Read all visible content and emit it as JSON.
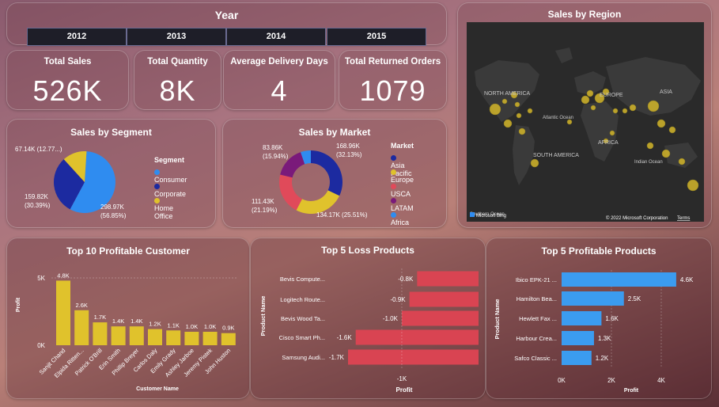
{
  "year_slicer": {
    "title": "Year",
    "years": [
      "2012",
      "2013",
      "2014",
      "2015"
    ]
  },
  "kpis": [
    {
      "label": "Total Sales",
      "value": "526K"
    },
    {
      "label": "Total Quantity",
      "value": "8K"
    },
    {
      "label": "Average Delivery Days",
      "value": "4"
    },
    {
      "label": "Total Returned Orders",
      "value": "1079"
    }
  ],
  "map": {
    "title": "Sales by Region",
    "labels": [
      "NORTH AMERICA",
      "EUROPE",
      "ASIA",
      "Atlantic Ocean",
      "AFRICA",
      "SOUTH AMERICA",
      "Indian Ocean",
      "Southern Ocean"
    ],
    "attribution": "© 2022 Microsoft Corporation",
    "terms": "Terms",
    "logo": "Microsoft Bing",
    "bubble_color": "#d4b62a"
  },
  "charts": {
    "segment": {
      "title": "Sales by Segment",
      "legend_title": "Segment"
    },
    "market": {
      "title": "Sales by Market",
      "legend_title": "Market"
    },
    "customers": {
      "title": "Top 10 Profitable Customer"
    },
    "loss": {
      "title": "Top 5 Loss Products"
    },
    "profit_products": {
      "title": "Top 5 Profitable Products"
    }
  },
  "chart_data": [
    {
      "type": "pie",
      "title": "Sales by Segment",
      "legend_title": "Segment",
      "slices": [
        {
          "name": "Consumer",
          "value": 298.97,
          "label": "298.97K",
          "pct": "(56.85%)",
          "color": "#2f8cf0"
        },
        {
          "name": "Corporate",
          "value": 159.82,
          "label": "159.82K",
          "pct": "(30.39%)",
          "color": "#1c2aa0"
        },
        {
          "name": "Home Office",
          "value": 67.14,
          "label": "67.14K (12.77...)",
          "pct": "",
          "color": "#e0c22c"
        }
      ]
    },
    {
      "type": "pie",
      "subtype": "donut",
      "title": "Sales by Market",
      "legend_title": "Market",
      "slices": [
        {
          "name": "Asia Pacific",
          "value": 168.96,
          "label": "168.96K",
          "pct": "(32.13%)",
          "color": "#1c2aa0"
        },
        {
          "name": "Europe",
          "value": 134.17,
          "label": "134.17K (25.51%)",
          "pct": "",
          "color": "#e0c22c"
        },
        {
          "name": "USCA",
          "value": 111.43,
          "label": "111.43K",
          "pct": "(21.19%)",
          "color": "#e04a5a"
        },
        {
          "name": "LATAM",
          "value": 83.86,
          "label": "83.86K",
          "pct": "(15.94%)",
          "color": "#7a1a7a"
        },
        {
          "name": "Africa",
          "value": 27.6,
          "label": "",
          "pct": "",
          "color": "#2f8cf0"
        }
      ]
    },
    {
      "type": "bar",
      "title": "Top 10 Profitable Customer",
      "xlabel": "Customer Name",
      "ylabel": "Profit",
      "yticks": [
        "0K",
        "5K"
      ],
      "ylim": [
        0,
        5000
      ],
      "color": "#e0c22c",
      "categories": [
        "Sanjit Chand",
        "Elpida Rittenbach",
        "Patrick O'Brill",
        "Erin Smith",
        "Phillip Breyer",
        "Carlos Daly",
        "Emily Grady",
        "Ashley Jarboe",
        "Jeremy Pistek",
        "John Huston"
      ],
      "tick_labels": [
        "Sanjit Chand",
        "Elpida Ritten...",
        "Patrick O'Brill",
        "Erin Smith",
        "Phillip Breyer",
        "Carlos Daly",
        "Emily Grady",
        "Ashley Jarboe",
        "Jeremy Pistek",
        "John Huston"
      ],
      "values": [
        4800,
        2600,
        1700,
        1400,
        1400,
        1200,
        1100,
        1000,
        1000,
        900
      ],
      "data_labels": [
        "4.8K",
        "2.6K",
        "1.7K",
        "1.4K",
        "1.4K",
        "1.2K",
        "1.1K",
        "1.0K",
        "1.0K",
        "0.9K"
      ]
    },
    {
      "type": "bar",
      "orientation": "horizontal",
      "title": "Top 5 Loss Products",
      "xlabel": "Profit",
      "ylabel": "Product Name",
      "xticks": [
        "-1K"
      ],
      "color": "#d94452",
      "categories": [
        "Bevis Compute...",
        "Logitech Route...",
        "Bevis Wood Ta...",
        "Cisco Smart Ph...",
        "Samsung Audi..."
      ],
      "values": [
        -800,
        -900,
        -1000,
        -1600,
        -1700
      ],
      "data_labels": [
        "-0.8K",
        "-0.9K",
        "-1.0K",
        "-1.6K",
        "-1.7K"
      ]
    },
    {
      "type": "bar",
      "orientation": "horizontal",
      "title": "Top 5 Profitable Products",
      "xlabel": "Profit",
      "ylabel": "Product Name",
      "xticks": [
        "0K",
        "2K",
        "4K"
      ],
      "xlim": [
        0,
        5000
      ],
      "color": "#3b9cf0",
      "categories": [
        "Ibico EPK-21 ...",
        "Hamilton Bea...",
        "Hewlett Fax ...",
        "Harbour Crea...",
        "Safco Classic ..."
      ],
      "values": [
        4600,
        2500,
        1600,
        1300,
        1200
      ],
      "data_labels": [
        "4.6K",
        "2.5K",
        "1.6K",
        "1.3K",
        "1.2K"
      ]
    }
  ]
}
